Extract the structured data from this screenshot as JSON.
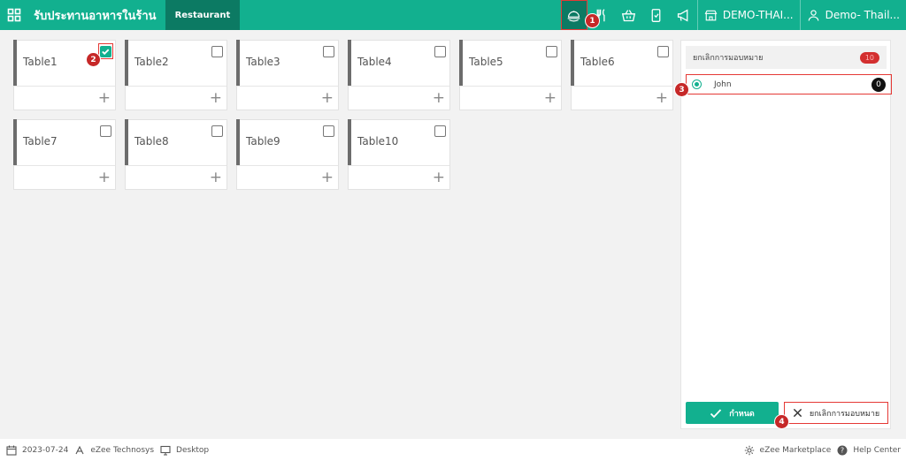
{
  "header": {
    "app_title": "รับประทานอาหารในร้าน",
    "outlet_tab": "Restaurant",
    "property_name": "DEMO-THAI...",
    "user_name": "Demo- Thail...",
    "icons": [
      "grid-icon",
      "waiter-assign-icon",
      "utensils-icon",
      "basket-icon",
      "mobile-order-icon",
      "megaphone-icon",
      "store-icon",
      "user-icon"
    ]
  },
  "tables": [
    {
      "name": "Table1",
      "checked": true
    },
    {
      "name": "Table2",
      "checked": false
    },
    {
      "name": "Table3",
      "checked": false
    },
    {
      "name": "Table4",
      "checked": false
    },
    {
      "name": "Table5",
      "checked": false
    },
    {
      "name": "Table6",
      "checked": false
    },
    {
      "name": "Table7",
      "checked": false
    },
    {
      "name": "Table8",
      "checked": false
    },
    {
      "name": "Table9",
      "checked": false
    },
    {
      "name": "Table10",
      "checked": false
    }
  ],
  "panel": {
    "heading": "ยกเลิกการมอบหมาย",
    "heading_count": "10",
    "waiter": {
      "name": "John",
      "count": "0",
      "selected": true
    },
    "assign_label": "กำหนด",
    "cancel_label": "ยกเลิกการมอบหมาย"
  },
  "steps": [
    "1",
    "2",
    "3",
    "4"
  ],
  "footer": {
    "date": "2023-07-24",
    "company": "eZee Technosys",
    "device": "Desktop",
    "marketplace": "eZee Marketplace",
    "help": "Help Center"
  },
  "colors": {
    "brand": "#12b08f",
    "brand_dark": "#0c7a63",
    "highlight": "#e53935",
    "step_marker": "#c62828"
  }
}
